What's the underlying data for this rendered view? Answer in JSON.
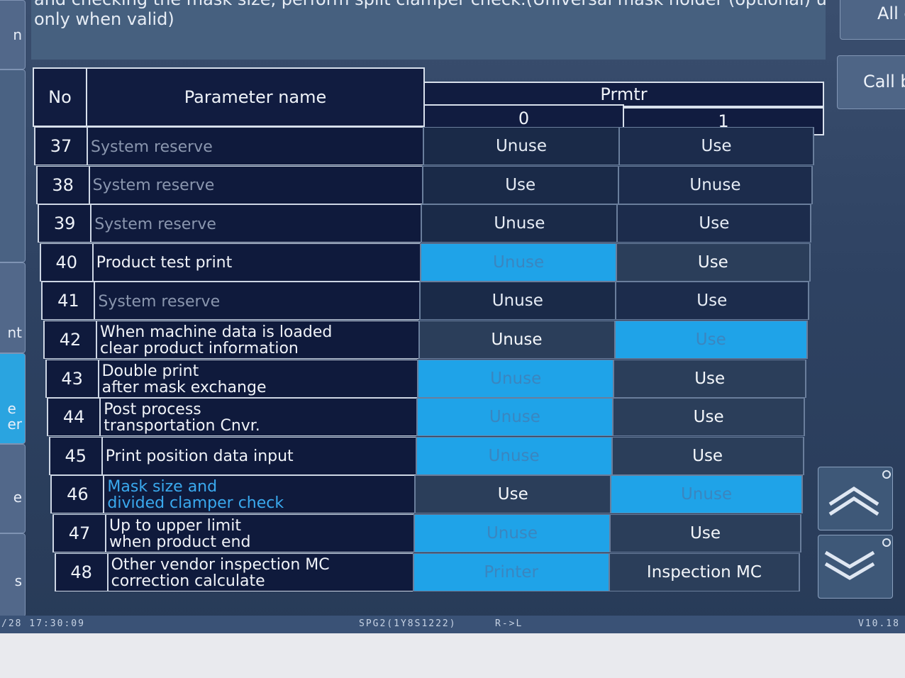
{
  "description": {
    "line1": "and checking the mask size, perform split clamper check.(Universal mask holder (optional) used",
    "line2": "only when valid)"
  },
  "left_buttons": [
    "n",
    "",
    "nt",
    "e\ner",
    "e",
    "s"
  ],
  "right_buttons": {
    "all": "All c",
    "call": "Call b"
  },
  "scroll": {
    "up": "scroll up",
    "down": "scroll down"
  },
  "table": {
    "header_no": "No",
    "header_name": "Parameter name",
    "header_prmtr": "Prmtr",
    "col0": "0",
    "col1": "1",
    "rows": [
      {
        "no": "37",
        "name": [
          "System reserve"
        ],
        "v0": "Unuse",
        "v1": "Use"
      },
      {
        "no": "38",
        "name": [
          "System reserve"
        ],
        "v0": "Use",
        "v1": "Unuse"
      },
      {
        "no": "39",
        "name": [
          "System reserve"
        ],
        "v0": "Unuse",
        "v1": "Use"
      },
      {
        "no": "40",
        "name": [
          "Product test print"
        ],
        "v0": "Unuse",
        "v1": "Use"
      },
      {
        "no": "41",
        "name": [
          "System reserve"
        ],
        "v0": "Unuse",
        "v1": "Use"
      },
      {
        "no": "42",
        "name": [
          "When machine data is loaded",
          "clear product information"
        ],
        "v0": "Unuse",
        "v1": "Use"
      },
      {
        "no": "43",
        "name": [
          "Double print",
          "after mask exchange"
        ],
        "v0": "Unuse",
        "v1": "Use"
      },
      {
        "no": "44",
        "name": [
          "Post process",
          "transportation Cnvr."
        ],
        "v0": "Unuse",
        "v1": "Use"
      },
      {
        "no": "45",
        "name": [
          "Print position data input"
        ],
        "v0": "Unuse",
        "v1": "Use"
      },
      {
        "no": "46",
        "name": [
          "Mask size and",
          "divided clamper check"
        ],
        "v0": "Use",
        "v1": "Unuse"
      },
      {
        "no": "47",
        "name": [
          "Up to upper limit",
          "when product end"
        ],
        "v0": "Unuse",
        "v1": "Use"
      },
      {
        "no": "48",
        "name": [
          "Other vendor inspection MC",
          "correction calculate"
        ],
        "v0": "Printer",
        "v1": "Inspection MC"
      }
    ]
  },
  "row_states": [
    {
      "dim": true,
      "sel": null
    },
    {
      "dim": true,
      "sel": null
    },
    {
      "dim": true,
      "sel": null
    },
    {
      "dim": false,
      "sel": 0
    },
    {
      "dim": true,
      "sel": null
    },
    {
      "dim": false,
      "sel": 1
    },
    {
      "dim": false,
      "sel": 0
    },
    {
      "dim": false,
      "sel": 0
    },
    {
      "dim": false,
      "sel": 0
    },
    {
      "dim": false,
      "sel": 1,
      "highlight": true
    },
    {
      "dim": false,
      "sel": 0
    },
    {
      "dim": false,
      "sel": 0
    }
  ],
  "status_bar": {
    "datetime": "/28 17:30:09",
    "program": "SPG2(1Y8S1222)",
    "direction": "R->L",
    "version": "V10.18"
  },
  "colors": {
    "selected": "#1fa3e8",
    "highlight_text": "#3aa9ee",
    "table_bg": "#0f1a3c"
  }
}
